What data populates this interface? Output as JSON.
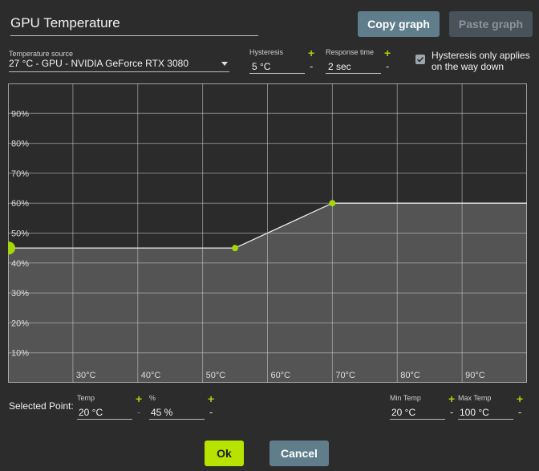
{
  "header": {
    "title": "GPU Temperature",
    "copy_label": "Copy graph",
    "paste_label": "Paste graph"
  },
  "source": {
    "label": "Temperature source",
    "value": "27 °C - GPU - NVIDIA GeForce RTX 3080"
  },
  "hysteresis": {
    "label": "Hysteresis",
    "value": "5 °C"
  },
  "response_time": {
    "label": "Response time",
    "value": "2 sec"
  },
  "hysteresis_down": {
    "label_line1": "Hysteresis only applies",
    "label_line2": "on the way down",
    "checked": true
  },
  "controls": {
    "plus": "+",
    "minus": "-"
  },
  "selected_point": {
    "label": "Selected Point:",
    "temp_label": "Temp",
    "temp_value": "20 °C",
    "percent_label": "%",
    "percent_value": "45 %"
  },
  "min_temp": {
    "label": "Min Temp",
    "value": "20 °C"
  },
  "max_temp": {
    "label": "Max Temp",
    "value": "100 °C"
  },
  "footer": {
    "ok_label": "Ok",
    "cancel_label": "Cancel"
  },
  "colors": {
    "accent": "#a6d608",
    "button": "#607d8b",
    "graph_bg": "#2b2b2b",
    "graph_fill": "#545454",
    "grid": "#cfcfcf"
  },
  "chart_data": {
    "type": "line",
    "x_ticks": [
      "30°C",
      "40°C",
      "50°C",
      "60°C",
      "70°C",
      "80°C",
      "90°C"
    ],
    "y_ticks": [
      "90%",
      "80%",
      "70%",
      "60%",
      "50%",
      "40%",
      "30%",
      "20%",
      "10%"
    ],
    "xlim": [
      20,
      100
    ],
    "ylim": [
      0,
      100
    ],
    "points": [
      {
        "x": 20,
        "y": 45,
        "selected": true
      },
      {
        "x": 55,
        "y": 45
      },
      {
        "x": 70,
        "y": 60
      }
    ],
    "extend_to": 100,
    "grid": true
  }
}
